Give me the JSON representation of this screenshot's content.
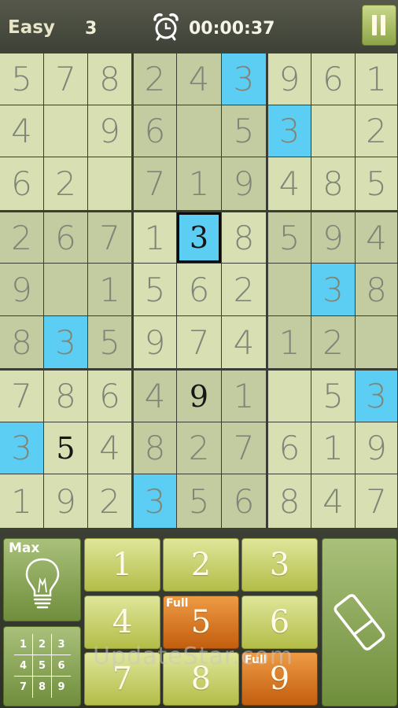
{
  "header": {
    "difficulty": "Easy",
    "hints_remaining": "3",
    "timer": "00:00:37",
    "clock_icon": "alarm-clock-icon",
    "pause_icon": "pause-icon"
  },
  "board": {
    "cells": [
      [
        {
          "v": "5"
        },
        {
          "v": "7"
        },
        {
          "v": "8"
        },
        {
          "v": "2"
        },
        {
          "v": "4"
        },
        {
          "v": "3",
          "hl": true
        },
        {
          "v": "9"
        },
        {
          "v": "6"
        },
        {
          "v": "1"
        }
      ],
      [
        {
          "v": "4"
        },
        {
          "v": ""
        },
        {
          "v": "9"
        },
        {
          "v": "6"
        },
        {
          "v": ""
        },
        {
          "v": "5"
        },
        {
          "v": "3",
          "hl": true
        },
        {
          "v": ""
        },
        {
          "v": "2"
        }
      ],
      [
        {
          "v": "6"
        },
        {
          "v": "2"
        },
        {
          "v": ""
        },
        {
          "v": "7"
        },
        {
          "v": "1"
        },
        {
          "v": "9"
        },
        {
          "v": "4"
        },
        {
          "v": "8"
        },
        {
          "v": "5"
        }
      ],
      [
        {
          "v": "2"
        },
        {
          "v": "6"
        },
        {
          "v": "7"
        },
        {
          "v": "1"
        },
        {
          "v": "3",
          "hl": true,
          "selected": true,
          "user": true
        },
        {
          "v": "8"
        },
        {
          "v": "5"
        },
        {
          "v": "9"
        },
        {
          "v": "4"
        }
      ],
      [
        {
          "v": "9"
        },
        {
          "v": ""
        },
        {
          "v": "1"
        },
        {
          "v": "5"
        },
        {
          "v": "6"
        },
        {
          "v": "2"
        },
        {
          "v": ""
        },
        {
          "v": "3",
          "hl": true
        },
        {
          "v": "8"
        }
      ],
      [
        {
          "v": "8"
        },
        {
          "v": "3",
          "hl": true
        },
        {
          "v": "5"
        },
        {
          "v": "9"
        },
        {
          "v": "7"
        },
        {
          "v": "4"
        },
        {
          "v": "1"
        },
        {
          "v": "2"
        },
        {
          "v": ""
        }
      ],
      [
        {
          "v": "7"
        },
        {
          "v": "8"
        },
        {
          "v": "6"
        },
        {
          "v": "4"
        },
        {
          "v": "9",
          "user": true
        },
        {
          "v": "1"
        },
        {
          "v": ""
        },
        {
          "v": "5"
        },
        {
          "v": "3",
          "hl": true
        }
      ],
      [
        {
          "v": "3",
          "hl": true
        },
        {
          "v": "5",
          "user": true
        },
        {
          "v": "4"
        },
        {
          "v": "8"
        },
        {
          "v": "2"
        },
        {
          "v": "7"
        },
        {
          "v": "6"
        },
        {
          "v": "1"
        },
        {
          "v": "9"
        }
      ],
      [
        {
          "v": "1"
        },
        {
          "v": "9"
        },
        {
          "v": "2"
        },
        {
          "v": "3",
          "hl": true
        },
        {
          "v": "5"
        },
        {
          "v": "6"
        },
        {
          "v": "8"
        },
        {
          "v": "4"
        },
        {
          "v": "7"
        }
      ]
    ]
  },
  "controls": {
    "hint_button": {
      "label": "Max",
      "icon": "lightbulb-icon"
    },
    "mini_grid_button": {
      "icon": "pencil-notes-grid-icon",
      "digits": [
        "1",
        "2",
        "3",
        "4",
        "5",
        "6",
        "7",
        "8",
        "9"
      ]
    },
    "number_buttons": [
      {
        "value": "1",
        "full": false
      },
      {
        "value": "2",
        "full": false
      },
      {
        "value": "3",
        "full": false
      },
      {
        "value": "4",
        "full": false
      },
      {
        "value": "5",
        "full": true
      },
      {
        "value": "6",
        "full": false
      },
      {
        "value": "7",
        "full": false
      },
      {
        "value": "8",
        "full": false
      },
      {
        "value": "9",
        "full": true
      }
    ],
    "full_label": "Full",
    "erase_button": {
      "icon": "eraser-icon"
    }
  },
  "watermark": "UpdateStar.com",
  "colors": {
    "highlight": "#5ccdf3",
    "cell_light": "#d7dfb3",
    "cell_dark": "#c3cba0",
    "number_button": "#cfd76e",
    "number_button_full": "#d9731f"
  }
}
